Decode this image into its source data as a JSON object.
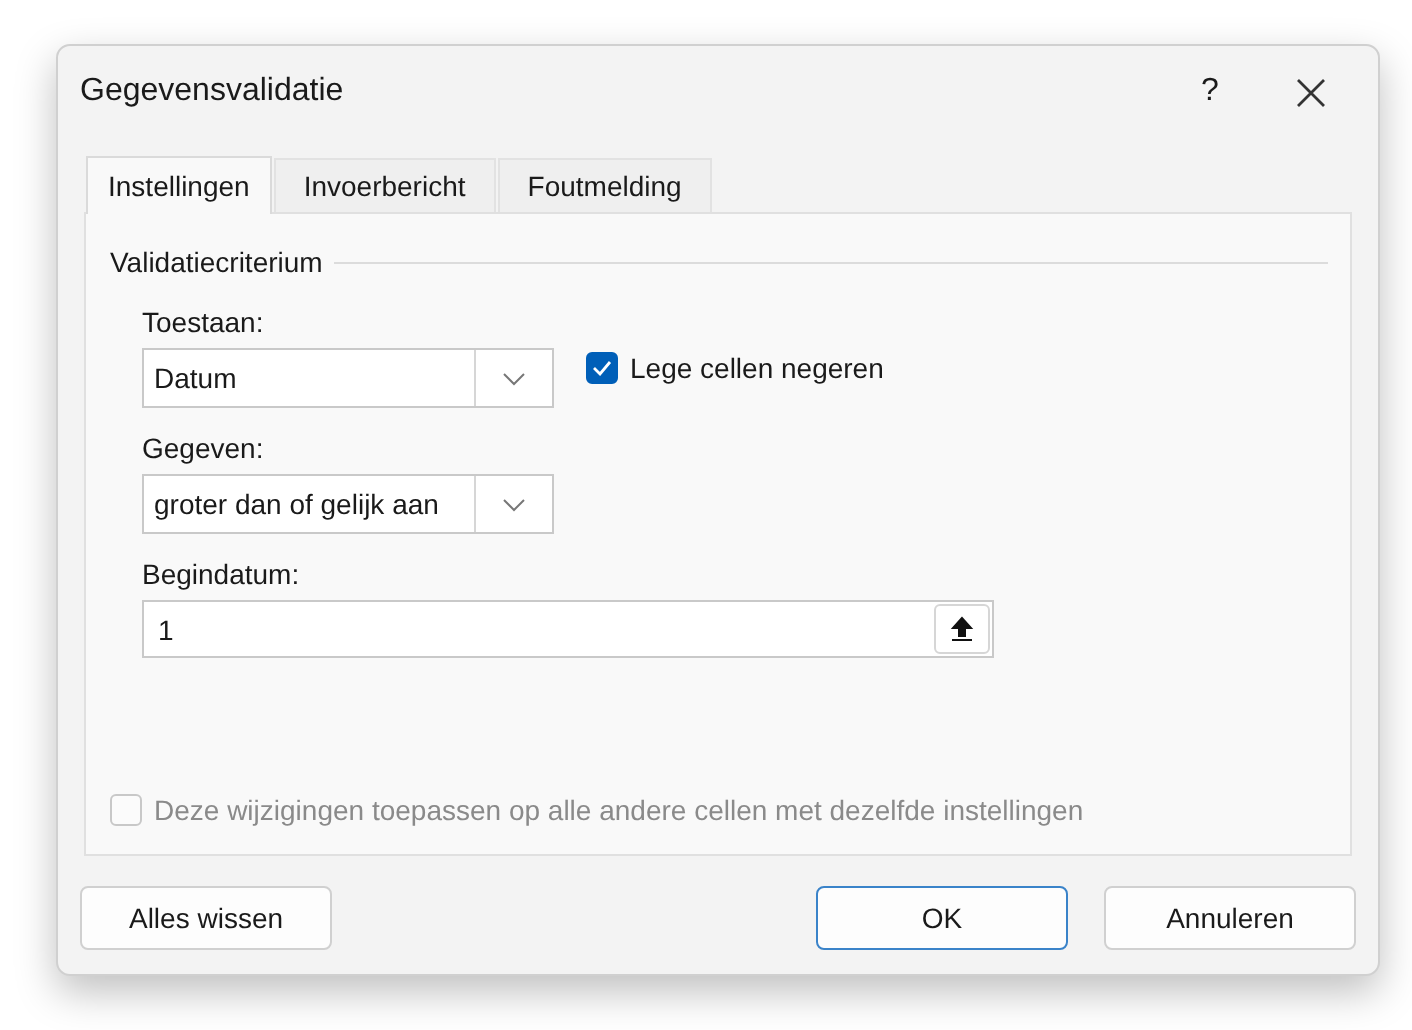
{
  "window": {
    "title": "Gegevensvalidatie",
    "help": "?"
  },
  "tabs": [
    {
      "label": "Instellingen",
      "selected": true
    },
    {
      "label": "Invoerbericht",
      "selected": false
    },
    {
      "label": "Foutmelding",
      "selected": false
    }
  ],
  "group": {
    "title": "Validatiecriterium"
  },
  "allow": {
    "label": "Toestaan:",
    "value": "Datum"
  },
  "ignore_blank": {
    "label": "Lege cellen negeren",
    "checked": true,
    "disabled": false
  },
  "data": {
    "label": "Gegeven:",
    "value": "groter dan of gelijk aan"
  },
  "start_date": {
    "label": "Begindatum:",
    "value": "1"
  },
  "apply_all": {
    "label": "Deze wijzigingen toepassen op alle andere cellen met dezelfde instellingen",
    "checked": false,
    "disabled": true
  },
  "buttons": [
    {
      "label": "Alles wissen",
      "default": false
    },
    {
      "label": "OK",
      "default": true
    },
    {
      "label": "Annuleren",
      "default": false
    }
  ]
}
